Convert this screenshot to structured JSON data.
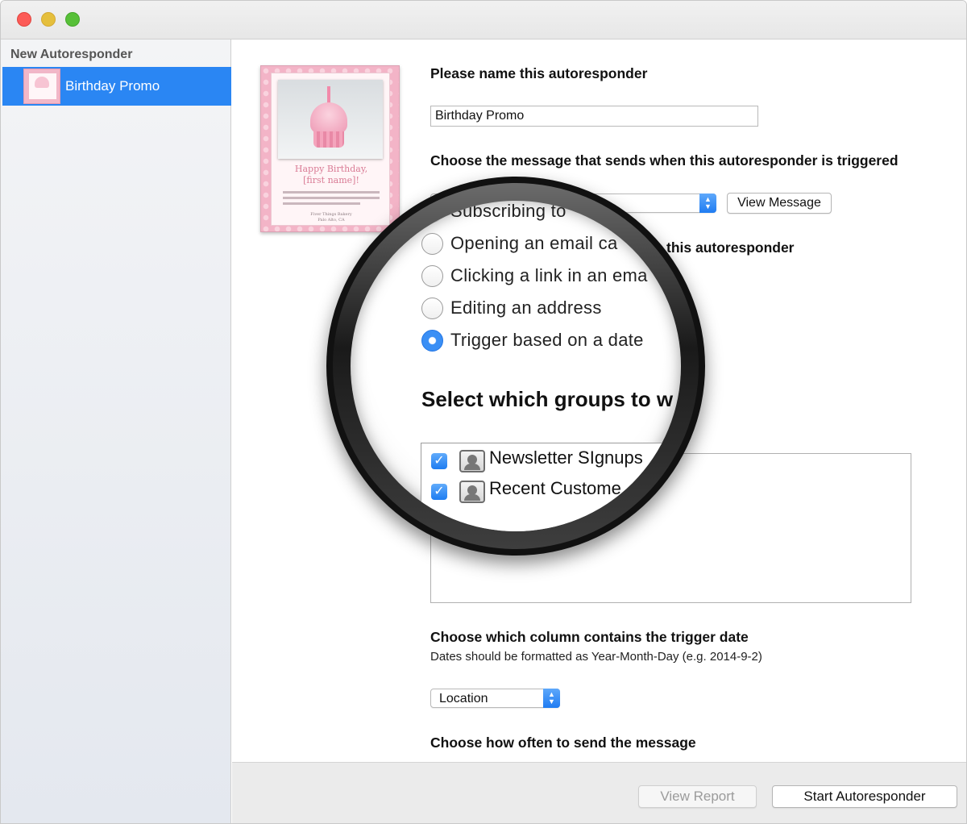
{
  "window": {
    "sidebar_header": "New Autoresponder",
    "sidebar_items": [
      {
        "label": "Birthday Promo"
      }
    ]
  },
  "preview": {
    "greeting_line1": "Happy Birthday,",
    "greeting_line2": "[first name]!",
    "signature_line1": "Fiver Things Bakery",
    "signature_line2": "Palo Alto, CA"
  },
  "form": {
    "name_heading": "Please name this autoresponder",
    "name_value": "Birthday Promo",
    "message_heading": "Choose the message that sends when this autoresponder is triggered",
    "view_message_button": "View Message",
    "trigger_heading_visible": "this autoresponder",
    "trigger_options": [
      {
        "label": "Subscribing to",
        "selected": false
      },
      {
        "label": "Opening an email ca",
        "selected": false
      },
      {
        "label": "Clicking a link in an ema",
        "selected": false
      },
      {
        "label": "Editing an address",
        "selected": false
      },
      {
        "label": "Trigger based on a date",
        "selected": true
      }
    ],
    "groups_heading": "Select which groups to w",
    "groups": [
      {
        "label": "Newsletter SIgnups",
        "checked": true
      },
      {
        "label": "Recent Custome",
        "checked": true
      }
    ],
    "date_column_heading": "Choose which column contains the trigger date",
    "date_column_hint": "Dates should be formatted as Year-Month-Day (e.g. 2014-9-2)",
    "date_column_value": "Location",
    "frequency_heading": "Choose how often to send the message"
  },
  "footer": {
    "view_report_button": "View Report",
    "start_button": "Start Autoresponder"
  },
  "colors": {
    "accent": "#2a86f3",
    "close": "#fc5b57",
    "minimize": "#e5bf3c",
    "zoom": "#57c038"
  }
}
